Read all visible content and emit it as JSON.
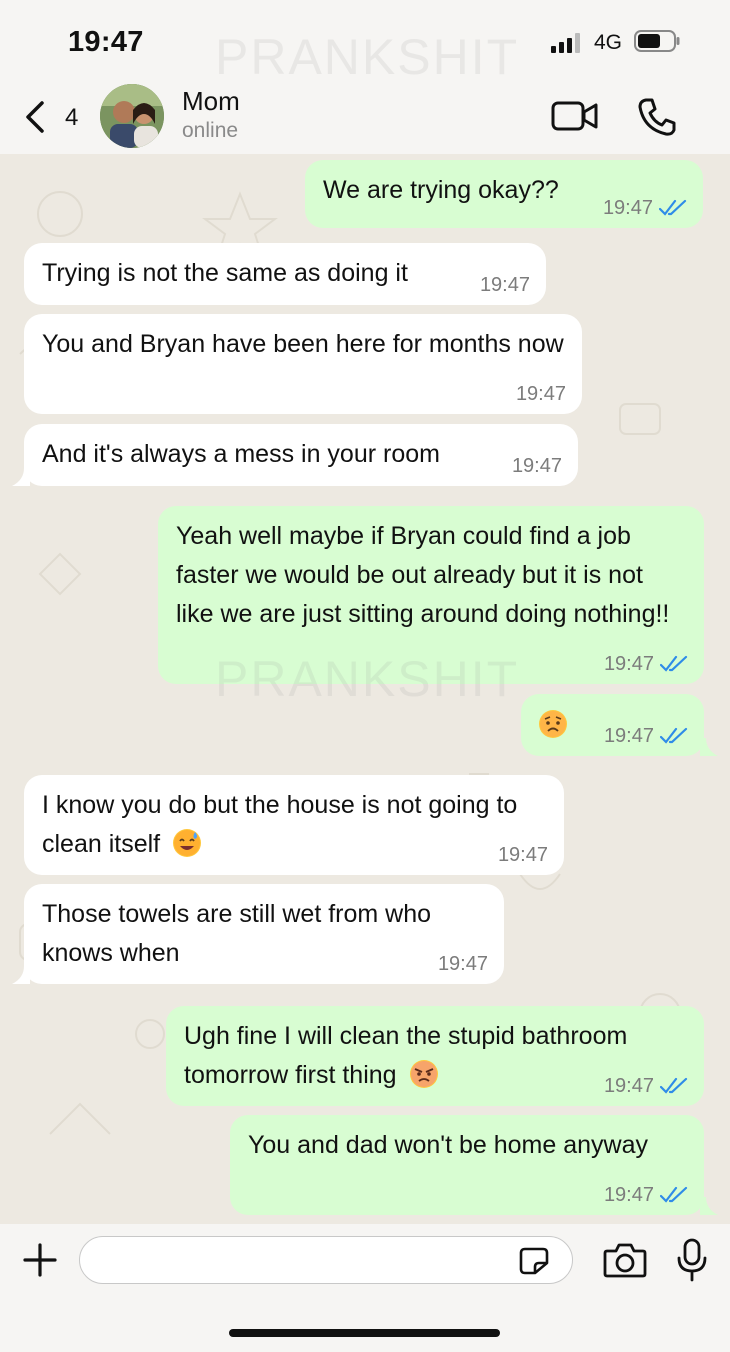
{
  "status_bar": {
    "time": "19:47",
    "network": "4G",
    "icons": [
      "signal-icon",
      "battery-icon"
    ]
  },
  "header": {
    "back_count": "4",
    "contact_name": "Mom",
    "contact_status": "online",
    "icons": [
      "back-chevron-icon",
      "video-call-icon",
      "phone-call-icon"
    ]
  },
  "messages": [
    {
      "direction": "out",
      "text": "We are trying okay??",
      "time": "19:47",
      "read": true
    },
    {
      "direction": "in",
      "text": "Trying is not the same as doing it",
      "time": "19:47"
    },
    {
      "direction": "in",
      "text": "You and Bryan have been here for months now",
      "time": "19:47"
    },
    {
      "direction": "in",
      "text": "And it's always a mess in your room",
      "time": "19:47"
    },
    {
      "direction": "out",
      "text": "Yeah well maybe if Bryan could find a job faster we would be out already but it is not like we are just sitting around doing nothing!!",
      "time": "19:47",
      "read": true
    },
    {
      "direction": "out",
      "text": "",
      "emoji": "worried-face-emoji",
      "time": "19:47",
      "read": true
    },
    {
      "direction": "in",
      "text": "I know you do but the house is not going to clean itself",
      "emoji": "sweat-smile-emoji",
      "time": "19:47"
    },
    {
      "direction": "in",
      "text": "Those towels are still wet from who knows when",
      "time": "19:47"
    },
    {
      "direction": "out",
      "text": "Ugh fine I will clean the stupid bathroom tomorrow first thing",
      "emoji": "angry-face-emoji",
      "time": "19:47",
      "read": true
    },
    {
      "direction": "out",
      "text": "You and dad won't be home anyway",
      "time": "19:47",
      "read": true
    }
  ],
  "watermark": "PRANKSHIT",
  "composer": {
    "placeholder": "",
    "icons": [
      "plus-icon",
      "sticker-icon",
      "camera-icon",
      "microphone-icon"
    ]
  },
  "colors": {
    "outgoing_bubble": "#d8fdd2",
    "incoming_bubble": "#ffffff",
    "read_ticks": "#2f8ce8",
    "chat_background": "#ede9e1"
  }
}
